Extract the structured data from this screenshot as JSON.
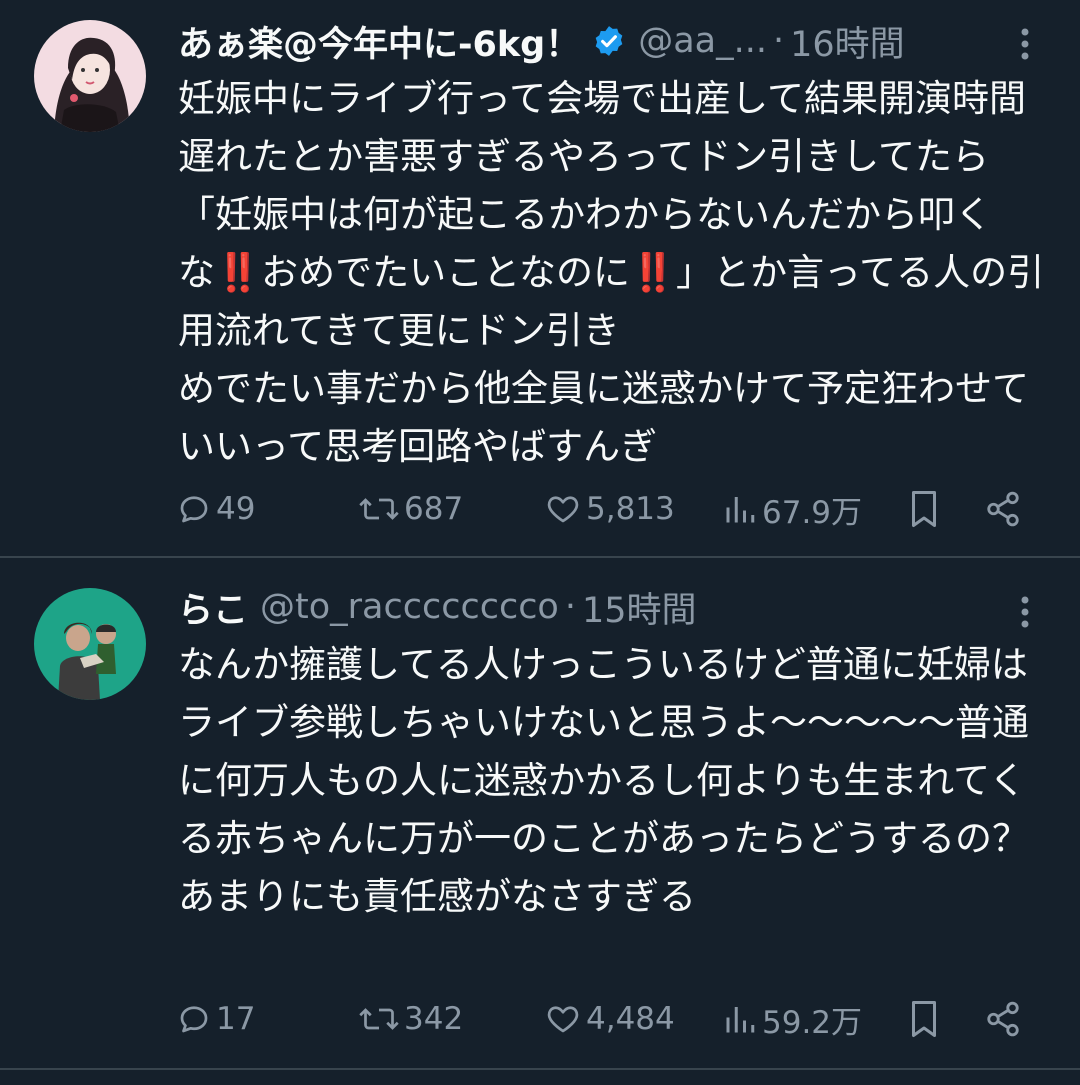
{
  "tweets": [
    {
      "display_name": "あぁ楽@今年中に-6kg！",
      "verified": true,
      "handle": "@aa_...",
      "separator": "·",
      "time": "16時間",
      "text": "妊娠中にライブ行って会場で出産して結果開演時間遅れたとか害悪すぎるやろってドン引きしてたら「妊娠中は何が起こるかわからないんだから叩くな‼️おめでたいことなのに‼️」とか言ってる人の引用流れてきて更にドン引き\nめでたい事だから他全員に迷惑かけて予定狂わせていいって思考回路やばすんぎ",
      "replies": "49",
      "retweets": "687",
      "likes": "5,813",
      "views": "67.9万",
      "avatar_icon": "avatar-illustration-woman"
    },
    {
      "display_name": "らこ",
      "verified": false,
      "handle": "@to_racccccccco",
      "separator": "·",
      "time": "15時間",
      "text": "なんか擁護してる人けっこういるけど普通に妊婦はライブ参戦しちゃいけないと思うよ〜〜〜〜〜普通に何万人もの人に迷惑かかるし何よりも生まれてくる赤ちゃんに万が一のことがあったらどうするの？あまりにも責任感がなさすぎる",
      "replies": "17",
      "retweets": "342",
      "likes": "4,484",
      "views": "59.2万",
      "avatar_icon": "avatar-photo-person"
    }
  ],
  "colors": {
    "background": "#15202b",
    "text": "#f7f9f9",
    "muted": "#8b98a5",
    "divider": "#38444d",
    "verified": "#1d9bf0",
    "avatar2_bg": "#1ea488"
  }
}
